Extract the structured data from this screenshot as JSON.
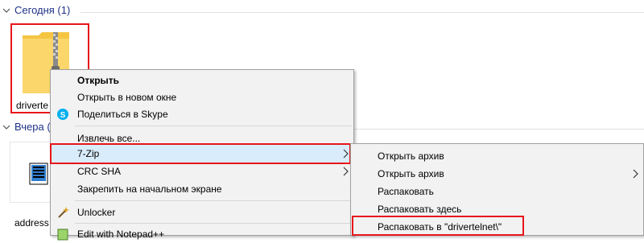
{
  "groups": {
    "today": "Сегодня (1)",
    "yesterday": "Вчера ("
  },
  "files": {
    "zip_name": "driverte",
    "addr_name": "address"
  },
  "context_menu": {
    "items": [
      {
        "label": "Открыть"
      },
      {
        "label": "Открыть в новом окне"
      },
      {
        "label": "Поделиться в Skype"
      },
      {
        "label": "Извлечь все..."
      },
      {
        "label": "7-Zip"
      },
      {
        "label": "CRC SHA"
      },
      {
        "label": "Закрепить на начальном экране"
      },
      {
        "label": "Unlocker"
      },
      {
        "label": "Edit with Notepad++"
      }
    ]
  },
  "submenu": {
    "items": [
      {
        "label": "Открыть архив"
      },
      {
        "label": "Открыть архив"
      },
      {
        "label": "Распаковать"
      },
      {
        "label": "Распаковать здесь"
      },
      {
        "label": "Распаковать в \"drivertelnet\\\""
      }
    ]
  },
  "colors": {
    "highlight_box": "#e8151b",
    "group_header": "#1e3287",
    "menu_bg": "#f2f2f2"
  }
}
